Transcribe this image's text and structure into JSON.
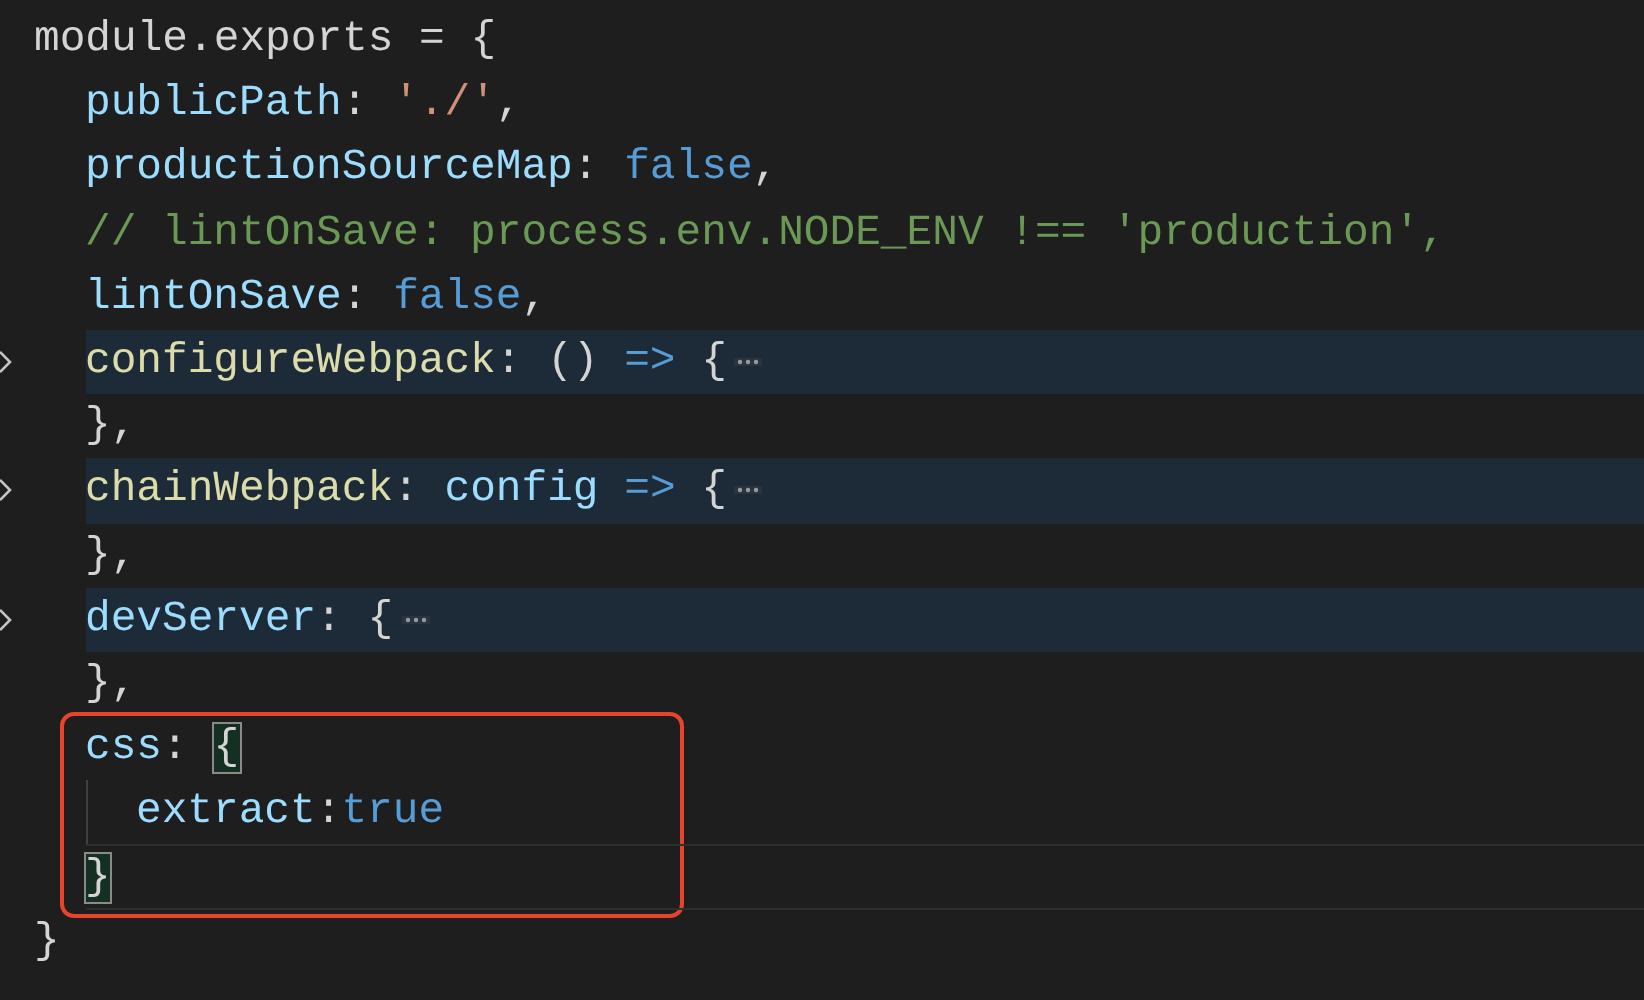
{
  "editor": {
    "lines": [
      {
        "tokens": [
          {
            "text": "module.exports = {",
            "kind": "plain"
          }
        ],
        "folded": false,
        "current": false,
        "boxed": false,
        "children": [
          {
            "tokens": [
              {
                "text": "publicPath",
                "kind": "property"
              },
              {
                "text": ": ",
                "kind": "plain"
              },
              {
                "text": "'./'",
                "kind": "string"
              },
              {
                "text": ",",
                "kind": "plain"
              }
            ],
            "folded": false,
            "current": false,
            "boxed": false
          },
          {
            "tokens": [
              {
                "text": "productionSourceMap",
                "kind": "property"
              },
              {
                "text": ": ",
                "kind": "plain"
              },
              {
                "text": "false",
                "kind": "keyword"
              },
              {
                "text": ",",
                "kind": "plain"
              }
            ],
            "folded": false,
            "current": false,
            "boxed": false
          },
          {
            "tokens": [
              {
                "text": "// lintOnSave: process.env.NODE_ENV !== 'production',",
                "kind": "comment"
              }
            ],
            "folded": false,
            "current": false,
            "boxed": false
          },
          {
            "tokens": [
              {
                "text": "lintOnSave",
                "kind": "property"
              },
              {
                "text": ": ",
                "kind": "plain"
              },
              {
                "text": "false",
                "kind": "keyword"
              },
              {
                "text": ",",
                "kind": "plain"
              }
            ],
            "folded": false,
            "current": false,
            "boxed": false
          },
          {
            "tokens": [
              {
                "text": "configureWebpack",
                "kind": "method"
              },
              {
                "text": ": () ",
                "kind": "plain"
              },
              {
                "text": "=>",
                "kind": "keyword"
              },
              {
                "text": " {",
                "kind": "plain"
              }
            ],
            "folded": true,
            "current": false,
            "boxed": false
          },
          {
            "tokens": [
              {
                "text": "},",
                "kind": "plain"
              }
            ],
            "folded": false,
            "current": false,
            "boxed": false
          },
          {
            "tokens": [
              {
                "text": "chainWebpack",
                "kind": "method"
              },
              {
                "text": ": ",
                "kind": "plain"
              },
              {
                "text": "config",
                "kind": "property"
              },
              {
                "text": " =>",
                "kind": "keyword"
              },
              {
                "text": " {",
                "kind": "plain"
              }
            ],
            "folded": true,
            "current": false,
            "boxed": false
          },
          {
            "tokens": [
              {
                "text": "},",
                "kind": "plain"
              }
            ],
            "folded": false,
            "current": false,
            "boxed": false
          },
          {
            "tokens": [
              {
                "text": "devServer",
                "kind": "property"
              },
              {
                "text": ": {",
                "kind": "plain"
              }
            ],
            "folded": true,
            "current": false,
            "boxed": false
          },
          {
            "tokens": [
              {
                "text": "},",
                "kind": "plain"
              }
            ],
            "folded": false,
            "current": false,
            "boxed": false
          },
          {
            "tokens": [
              {
                "text": "css",
                "kind": "property"
              },
              {
                "text": ": ",
                "kind": "plain"
              },
              {
                "text": "{",
                "kind": "bracket-match"
              }
            ],
            "folded": false,
            "current": false,
            "boxed": true,
            "children": [
              {
                "tokens": [
                  {
                    "text": "extract",
                    "kind": "property"
                  },
                  {
                    "text": ":",
                    "kind": "plain"
                  },
                  {
                    "text": "true",
                    "kind": "keyword"
                  }
                ],
                "folded": false,
                "current": false,
                "boxed": false
              }
            ]
          },
          {
            "tokens": [
              {
                "text": "}",
                "kind": "bracket-match"
              }
            ],
            "folded": false,
            "current": true,
            "boxed": true
          }
        ]
      },
      {
        "tokens": [
          {
            "text": "}",
            "kind": "plain"
          }
        ],
        "folded": false,
        "current": false,
        "boxed": false
      }
    ]
  }
}
